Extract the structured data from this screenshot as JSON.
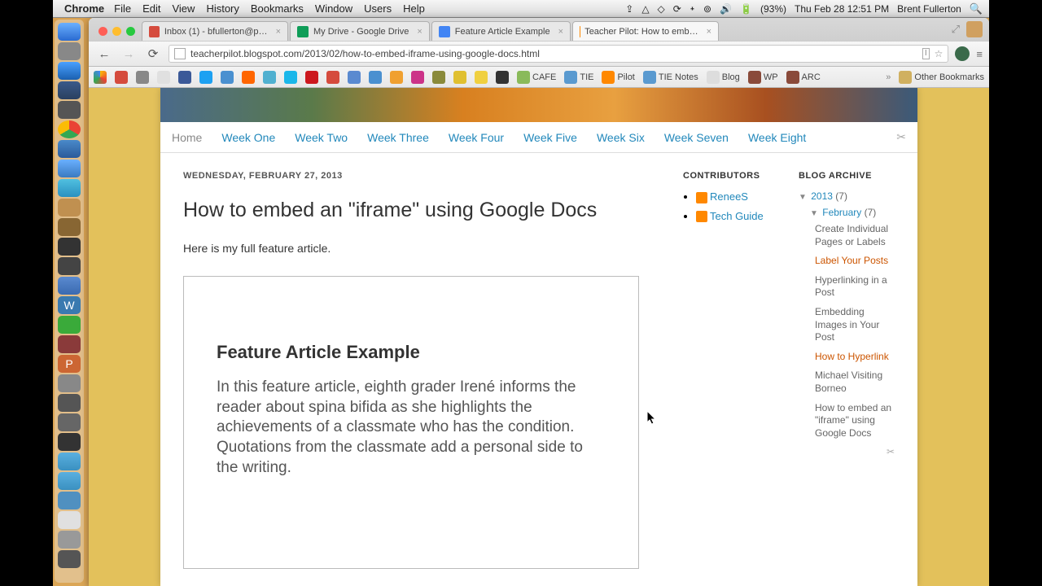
{
  "menubar": {
    "app": "Chrome",
    "items": [
      "File",
      "Edit",
      "View",
      "History",
      "Bookmarks",
      "Window",
      "Users",
      "Help"
    ],
    "battery": "(93%)",
    "datetime": "Thu Feb 28  12:51 PM",
    "user": "Brent Fullerton"
  },
  "tabs": [
    {
      "label": "Inbox (1) - bfullerton@p…",
      "color": "#d54b3d"
    },
    {
      "label": "My Drive - Google Drive",
      "color": "#0f9d58"
    },
    {
      "label": "Feature Article Example",
      "color": "#4285f4"
    },
    {
      "label": "Teacher Pilot: How to emb…",
      "color": "#ff8800"
    }
  ],
  "url": "teacherpilot.blogspot.com/2013/02/how-to-embed-iframe-using-google-docs.html",
  "bookmarks": {
    "named": [
      "CAFE",
      "TIE",
      "Pilot",
      "TIE Notes",
      "Blog",
      "WP",
      "ARC"
    ],
    "other": "Other Bookmarks"
  },
  "blog": {
    "nav": [
      "Home",
      "Week One",
      "Week Two",
      "Week Three",
      "Week Four",
      "Week Five",
      "Week Six",
      "Week Seven",
      "Week Eight"
    ],
    "date": "WEDNESDAY, FEBRUARY 27, 2013",
    "title": "How to embed an \"iframe\" using Google Docs",
    "body": "Here is my full feature article.",
    "iframe": {
      "title": "Feature Article Example",
      "body": "In this feature article, eighth grader Irené informs the reader about spina bifida as she highlights the achievements of a classmate who has the condition. Quotations from the classmate add a personal side to the writing."
    },
    "contributors_h": "CONTRIBUTORS",
    "contributors": [
      "ReneeS",
      "Tech Guide"
    ],
    "archive_h": "BLOG ARCHIVE",
    "archive": {
      "year": "2013",
      "year_count": "(7)",
      "month": "February",
      "month_count": "(7)",
      "posts": [
        "Create Individual Pages or Labels",
        "Label Your Posts",
        "Hyperlinking in a Post",
        "Embedding Images in Your Post",
        "How to Hyperlink",
        "Michael Visiting Borneo",
        "How to embed an \"iframe\" using Google Docs"
      ]
    }
  }
}
